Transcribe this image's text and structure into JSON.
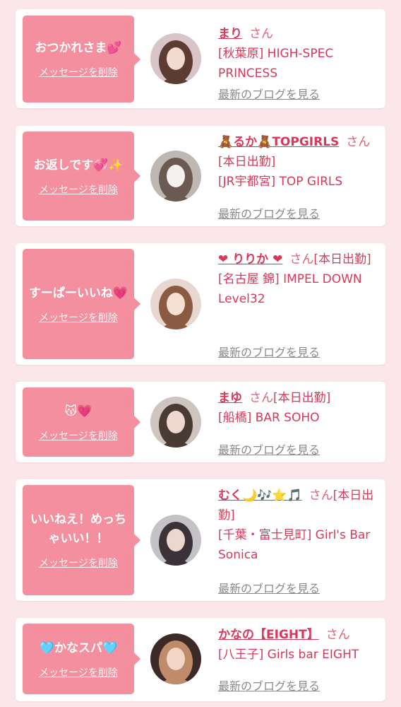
{
  "messages": [
    {
      "message": "おつかれさま💕",
      "delete_label": "メッセージを削除",
      "name": "まり",
      "honorific": "さん",
      "detail": "[秋葉原] HIGH-SPEC PRINCESS",
      "blog_label": "最新のブログを見る",
      "avatar_colors": [
        "#d9c4c8",
        "#5c3b30",
        "#f3dad0"
      ]
    },
    {
      "message": "お返しです💞✨",
      "delete_label": "メッセージを削除",
      "name": "🧸るか🧸TOPGIRLS",
      "honorific": "さん",
      "detail": "[本日出勤]",
      "detail2": "[JR宇都宮] TOP GIRLS",
      "blog_label": "最新のブログを見る",
      "avatar_colors": [
        "#bfb7b3",
        "#6b5a52",
        "#f4f2f0"
      ]
    },
    {
      "message": "すーぱーいいね💗",
      "delete_label": "メッセージを削除",
      "name": "❤ りりか ❤",
      "honorific": "さん",
      "detail": "[本日出勤]",
      "detail2": "[名古屋 錦] IMPEL DOWN Level32",
      "blog_label": "最新のブログを見る",
      "avatar_colors": [
        "#e8d7cf",
        "#8a5a42",
        "#f6dfd3"
      ]
    },
    {
      "message": "😽💗",
      "delete_label": "メッセージを削除",
      "name": "まゆ",
      "honorific": "さん",
      "detail": "[本日出勤]",
      "detail2": "[船橋] BAR SOHO",
      "blog_label": "最新のブログを見る",
      "avatar_colors": [
        "#cfc4bf",
        "#4a3a34",
        "#efd8cf"
      ]
    },
    {
      "message": "いいねえ！めっちゃいい！！",
      "delete_label": "メッセージを削除",
      "name": "むく🌙🎶⭐🎵",
      "honorific": "さん",
      "detail": "[本日出勤]",
      "detail2": "[千葉・富士見町] Girl's Bar Sonica",
      "blog_label": "最新のブログを見る",
      "avatar_colors": [
        "#c4c2c6",
        "#3a3236",
        "#ecd6d0"
      ]
    },
    {
      "message": "🩵かなスパ🩵",
      "delete_label": "メッセージを削除",
      "name": "かなの【EIGHT】",
      "honorific": "さん",
      "detail": "[八王子] Girls bar EIGHT",
      "blog_label": "最新のブログを見る",
      "avatar_colors": [
        "#3b2a28",
        "#c08b6a",
        "#f2d5c6"
      ]
    }
  ]
}
